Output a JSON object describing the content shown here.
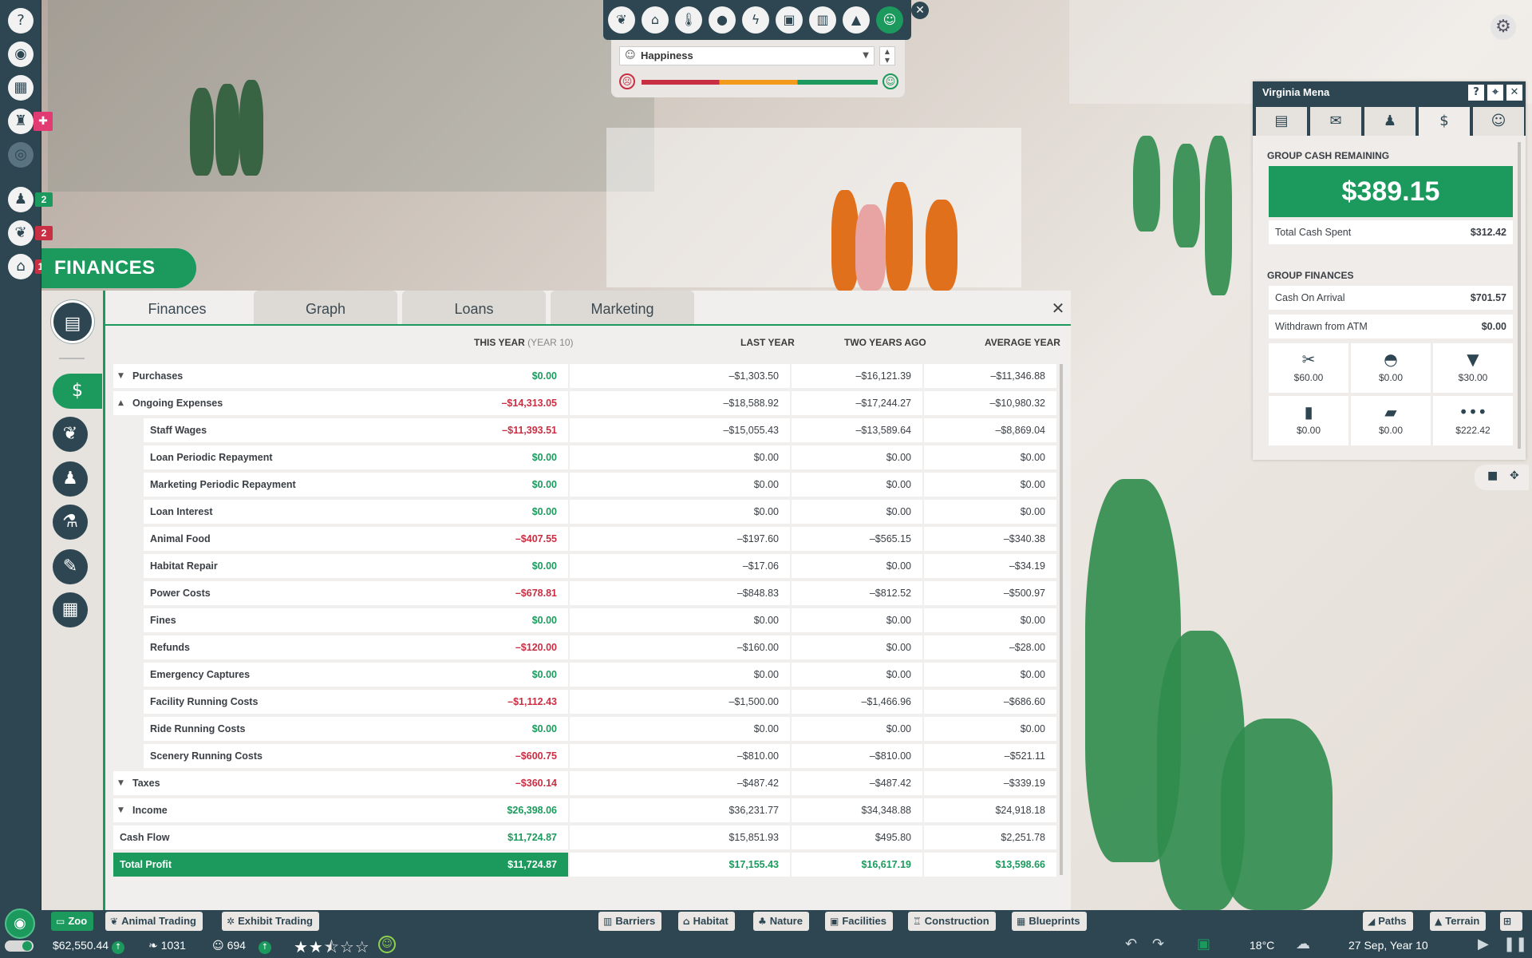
{
  "overlay": {
    "selected": "Happiness"
  },
  "finances": {
    "header": "FINANCES",
    "tabs": [
      "Finances",
      "Graph",
      "Loans",
      "Marketing"
    ],
    "columns": {
      "this_year": "THIS YEAR",
      "this_year_note": "(YEAR 10)",
      "last_year": "LAST YEAR",
      "two_years_ago": "TWO YEARS AGO",
      "average_year": "AVERAGE YEAR"
    },
    "rows": [
      {
        "label": "Purchases",
        "this_year": "$0.00",
        "last_year": "–$1,303.50",
        "two_years_ago": "–$16,121.39",
        "average_year": "–$11,346.88"
      },
      {
        "label": "Ongoing Expenses",
        "this_year": "–$14,313.05",
        "last_year": "–$18,588.92",
        "two_years_ago": "–$17,244.27",
        "average_year": "–$10,980.32"
      },
      {
        "label": "Staff Wages",
        "this_year": "–$11,393.51",
        "last_year": "–$15,055.43",
        "two_years_ago": "–$13,589.64",
        "average_year": "–$8,869.04"
      },
      {
        "label": "Loan Periodic Repayment",
        "this_year": "$0.00",
        "last_year": "$0.00",
        "two_years_ago": "$0.00",
        "average_year": "$0.00"
      },
      {
        "label": "Marketing Periodic Repayment",
        "this_year": "$0.00",
        "last_year": "$0.00",
        "two_years_ago": "$0.00",
        "average_year": "$0.00"
      },
      {
        "label": "Loan Interest",
        "this_year": "$0.00",
        "last_year": "$0.00",
        "two_years_ago": "$0.00",
        "average_year": "$0.00"
      },
      {
        "label": "Animal Food",
        "this_year": "–$407.55",
        "last_year": "–$197.60",
        "two_years_ago": "–$565.15",
        "average_year": "–$340.38"
      },
      {
        "label": "Habitat Repair",
        "this_year": "$0.00",
        "last_year": "–$17.06",
        "two_years_ago": "$0.00",
        "average_year": "–$34.19"
      },
      {
        "label": "Power Costs",
        "this_year": "–$678.81",
        "last_year": "–$848.83",
        "two_years_ago": "–$812.52",
        "average_year": "–$500.97"
      },
      {
        "label": "Fines",
        "this_year": "$0.00",
        "last_year": "$0.00",
        "two_years_ago": "$0.00",
        "average_year": "$0.00"
      },
      {
        "label": "Refunds",
        "this_year": "–$120.00",
        "last_year": "–$160.00",
        "two_years_ago": "$0.00",
        "average_year": "–$28.00"
      },
      {
        "label": "Emergency Captures",
        "this_year": "$0.00",
        "last_year": "$0.00",
        "two_years_ago": "$0.00",
        "average_year": "$0.00"
      },
      {
        "label": "Facility Running Costs",
        "this_year": "–$1,112.43",
        "last_year": "–$1,500.00",
        "two_years_ago": "–$1,466.96",
        "average_year": "–$686.60"
      },
      {
        "label": "Ride Running Costs",
        "this_year": "$0.00",
        "last_year": "$0.00",
        "two_years_ago": "$0.00",
        "average_year": "$0.00"
      },
      {
        "label": "Scenery Running Costs",
        "this_year": "–$600.75",
        "last_year": "–$810.00",
        "two_years_ago": "–$810.00",
        "average_year": "–$521.11"
      },
      {
        "label": "Taxes",
        "this_year": "–$360.14",
        "last_year": "–$487.42",
        "two_years_ago": "–$487.42",
        "average_year": "–$339.19"
      },
      {
        "label": "Income",
        "this_year": "$26,398.06",
        "last_year": "$36,231.77",
        "two_years_ago": "$34,348.88",
        "average_year": "$24,918.18"
      },
      {
        "label": "Cash Flow",
        "this_year": "$11,724.87",
        "last_year": "$15,851.93",
        "two_years_ago": "$495.80",
        "average_year": "$2,251.78"
      },
      {
        "label": "Total Profit",
        "this_year": "$11,724.87",
        "last_year": "$17,155.43",
        "two_years_ago": "$16,617.19",
        "average_year": "$13,598.66"
      }
    ]
  },
  "guest_panel": {
    "title": "Virginia Mena",
    "cash_section": "GROUP CASH REMAINING",
    "cash_remaining": "$389.15",
    "total_spent_label": "Total Cash Spent",
    "total_spent": "$312.42",
    "finances_section": "GROUP FINANCES",
    "cash_on_arrival_label": "Cash On Arrival",
    "cash_on_arrival": "$701.57",
    "withdrawn_label": "Withdrawn from ATM",
    "withdrawn": "$0.00",
    "tiles": [
      {
        "icon": "ticket-icon",
        "value": "$60.00"
      },
      {
        "icon": "burger-icon",
        "value": "$0.00"
      },
      {
        "icon": "drink-icon",
        "value": "$30.00"
      },
      {
        "icon": "shopping-bag-icon",
        "value": "$0.00"
      },
      {
        "icon": "transport-icon",
        "value": "$0.00"
      },
      {
        "icon": "more-icon",
        "value": "$222.42"
      }
    ]
  },
  "left_rail": {
    "badges": [
      "2",
      "2",
      "1"
    ]
  },
  "bottom_bar": {
    "left_tabs": [
      "Zoo",
      "Animal Trading",
      "Exhibit Trading"
    ],
    "build_tabs": [
      "Barriers",
      "Habitat",
      "Nature",
      "Facilities",
      "Construction",
      "Blueprints"
    ],
    "right_tabs": [
      "Paths",
      "Terrain"
    ],
    "money": "$62,550.44",
    "conservation": "1031",
    "guests": "694",
    "zoo_rating": 2.5,
    "temperature": "18°C",
    "date": "27 Sep, Year 10"
  }
}
